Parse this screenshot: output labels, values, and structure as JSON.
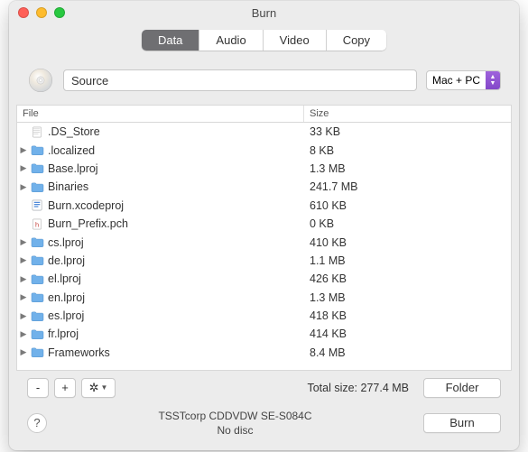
{
  "window": {
    "title": "Burn"
  },
  "tabs": [
    {
      "label": "Data",
      "active": true
    },
    {
      "label": "Audio",
      "active": false
    },
    {
      "label": "Video",
      "active": false
    },
    {
      "label": "Copy",
      "active": false
    }
  ],
  "source": {
    "value": "Source",
    "format_label": "Mac + PC"
  },
  "columns": {
    "file": "File",
    "size": "Size"
  },
  "rows": [
    {
      "name": ".DS_Store",
      "size": "33 KB",
      "kind": "file",
      "expandable": false
    },
    {
      "name": ".localized",
      "size": "8 KB",
      "kind": "folder",
      "expandable": true
    },
    {
      "name": "Base.lproj",
      "size": "1.3 MB",
      "kind": "folder",
      "expandable": true
    },
    {
      "name": "Binaries",
      "size": "241.7 MB",
      "kind": "folder",
      "expandable": true
    },
    {
      "name": "Burn.xcodeproj",
      "size": "610 KB",
      "kind": "proj",
      "expandable": false
    },
    {
      "name": "Burn_Prefix.pch",
      "size": "0 KB",
      "kind": "hfile",
      "expandable": false
    },
    {
      "name": "cs.lproj",
      "size": "410 KB",
      "kind": "folder",
      "expandable": true
    },
    {
      "name": "de.lproj",
      "size": "1.1 MB",
      "kind": "folder",
      "expandable": true
    },
    {
      "name": "el.lproj",
      "size": "426 KB",
      "kind": "folder",
      "expandable": true
    },
    {
      "name": "en.lproj",
      "size": "1.3 MB",
      "kind": "folder",
      "expandable": true
    },
    {
      "name": "es.lproj",
      "size": "418 KB",
      "kind": "folder",
      "expandable": true
    },
    {
      "name": "fr.lproj",
      "size": "414 KB",
      "kind": "folder",
      "expandable": true
    },
    {
      "name": "Frameworks",
      "size": "8.4 MB",
      "kind": "folder",
      "expandable": true
    }
  ],
  "toolbar": {
    "remove": "-",
    "add": "+",
    "total_label": "Total size: 277.4 MB",
    "folder": "Folder"
  },
  "device": {
    "line1": "TSSTcorp CDDVDW SE-S084C",
    "line2": "No disc"
  },
  "burn_label": "Burn",
  "help_label": "?"
}
